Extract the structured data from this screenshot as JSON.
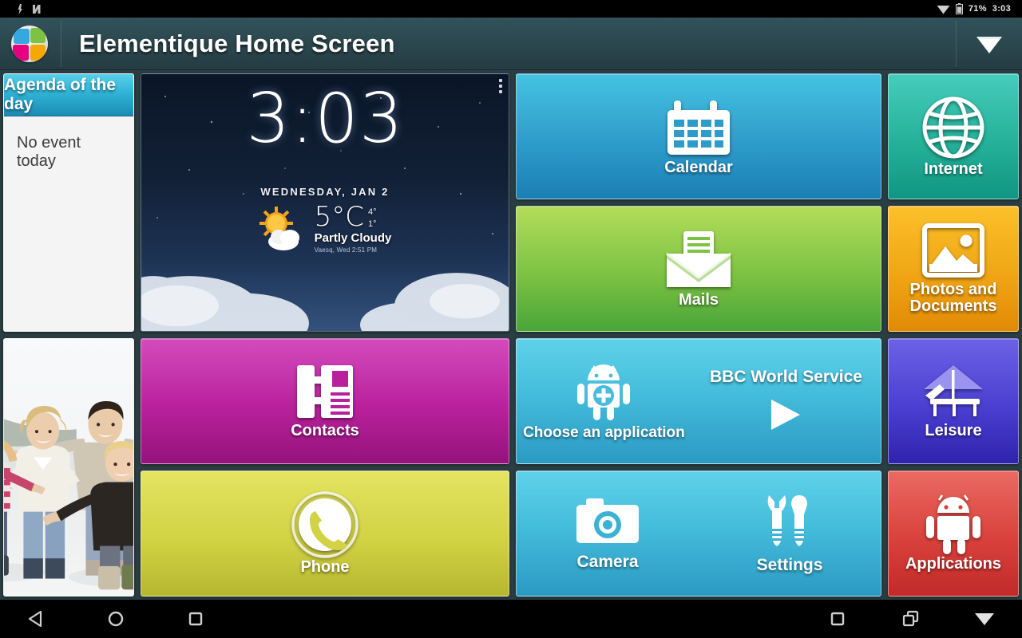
{
  "status_bar": {
    "left_icons": [
      "usb-debug-icon",
      "sync-icon"
    ],
    "wifi_icon": "wifi-icon",
    "battery_icon": "battery-icon",
    "battery_percent": "71%",
    "clock": "3:03"
  },
  "app_bar": {
    "logo_icon": "elementique-puzzle-logo",
    "title": "Elementique Home Screen",
    "right_icon": "wifi-icon"
  },
  "tiles": {
    "calendar": {
      "label": "Calendar",
      "icon": "calendar-icon",
      "color": "#2e9ccb"
    },
    "mails": {
      "label": "Mails",
      "icon": "mail-icon",
      "color": "#7dc242"
    },
    "contacts": {
      "label": "Contacts",
      "icon": "contacts-book-icon",
      "color": "#b9219c"
    },
    "phone": {
      "label": "Phone",
      "icon": "phone-icon",
      "color": "#d2d244"
    },
    "internet": {
      "label": "Internet",
      "icon": "globe-icon",
      "color": "#24b199"
    },
    "photos": {
      "label": "Photos and Documents",
      "icon": "image-icon",
      "color": "#f0a515"
    },
    "leisure": {
      "label": "Leisure",
      "icon": "beach-chair-icon",
      "color": "#4a3fd1"
    },
    "applications": {
      "label": "Applications",
      "icon": "android-robot-icon",
      "color": "#d9413c"
    }
  },
  "agenda": {
    "title": "Agenda of the day",
    "empty_text": "No event today"
  },
  "clock_widget": {
    "time": "3:03",
    "date": "WEDNESDAY, JAN 2",
    "weather_icon": "partly-cloudy-icon",
    "temperature": "5°C",
    "high": "4°",
    "low": "1°",
    "condition": "Partly Cloudy",
    "meta": "Vaesq, Wed 2:51 PM",
    "overflow_icon": "overflow-menu-icon"
  },
  "media_widget": {
    "choose_icon": "android-add-icon",
    "choose_label": "Choose an application",
    "station": "BBC World Service",
    "play_icon": "play-icon"
  },
  "shortcuts": [
    {
      "label": "Camera",
      "icon": "camera-icon"
    },
    {
      "label": "Settings",
      "icon": "tools-icon"
    }
  ],
  "photo_widget": {
    "alt": "family-running-on-beach-photo"
  },
  "nav_bar": {
    "back_icon": "back-triangle-icon",
    "home_icon": "home-circle-icon",
    "recents_icon": "recents-square-icon",
    "screenshot_icon": "screenshot-square-icon",
    "multiwindow_icon": "multi-window-icon",
    "wifi_icon": "wifi-icon"
  }
}
